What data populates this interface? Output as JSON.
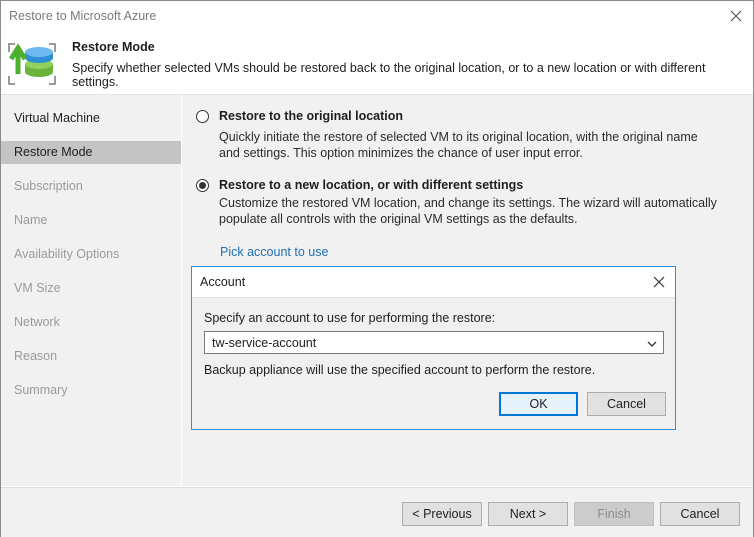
{
  "window": {
    "title": "Restore to Microsoft Azure"
  },
  "header": {
    "title": "Restore Mode",
    "description": "Specify whether selected VMs should be restored back to the original location, or to a new location or with different settings."
  },
  "sidebar": {
    "items": [
      {
        "label": "Virtual Machine",
        "state": "done"
      },
      {
        "label": "Restore Mode",
        "state": "active"
      },
      {
        "label": "Subscription",
        "state": "pending"
      },
      {
        "label": "Name",
        "state": "pending"
      },
      {
        "label": "Availability Options",
        "state": "pending"
      },
      {
        "label": "VM Size",
        "state": "pending"
      },
      {
        "label": "Network",
        "state": "pending"
      },
      {
        "label": "Reason",
        "state": "pending"
      },
      {
        "label": "Summary",
        "state": "pending"
      }
    ]
  },
  "options": {
    "original": {
      "title": "Restore to the original location",
      "description": "Quickly initiate the restore of selected VM to its original location, with the original name and settings. This option minimizes the chance of user input error.",
      "selected": false
    },
    "new": {
      "title": "Restore to a new location, or with different settings",
      "description": "Customize the restored VM location, and change its settings. The wizard will automatically populate all controls with the original VM settings as the defaults.",
      "selected": true
    },
    "pick_account_link": "Pick account to use"
  },
  "dialog": {
    "title": "Account",
    "label": "Specify an account to use for performing the restore:",
    "selected_account": "tw-service-account",
    "note": "Backup appliance will use the specified account to perform the restore.",
    "ok_label": "OK",
    "cancel_label": "Cancel"
  },
  "footer": {
    "previous_label": "< Previous",
    "next_label": "Next >",
    "finish_label": "Finish",
    "cancel_label": "Cancel"
  },
  "colors": {
    "accent": "#0078d7",
    "link": "#1f6fb6",
    "panel": "#f1f1f1",
    "nav_active": "#c4c4c4"
  }
}
